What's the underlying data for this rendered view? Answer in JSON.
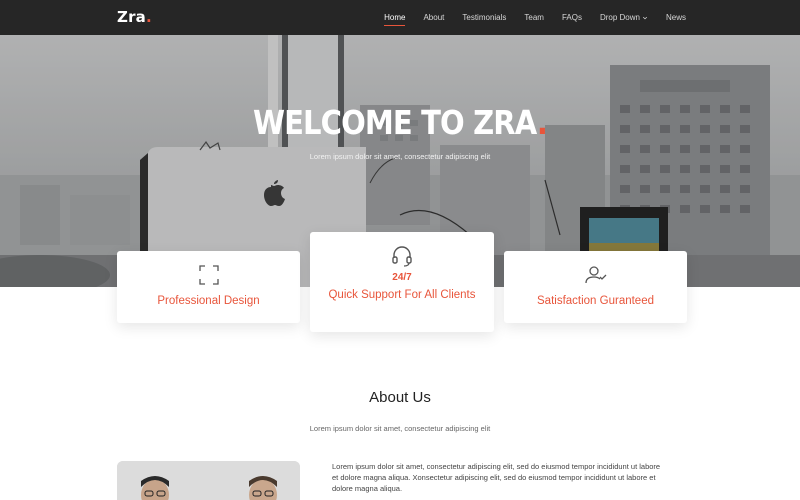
{
  "brand": {
    "name": "Zra",
    "dot": "."
  },
  "nav": {
    "items": [
      {
        "label": "Home",
        "active": true
      },
      {
        "label": "About"
      },
      {
        "label": "Testimonials"
      },
      {
        "label": "Team"
      },
      {
        "label": "FAQs"
      },
      {
        "label": "Drop Down",
        "has_dropdown": true
      },
      {
        "label": "News"
      }
    ]
  },
  "hero": {
    "title": "WELCOME TO ZRA",
    "title_dot": ".",
    "subtitle": "Lorem ipsum dolor sit amet, consectetur adipiscing elit"
  },
  "features": [
    {
      "icon": "expand-icon",
      "title": "Professional Design"
    },
    {
      "icon": "headset-icon",
      "tag": "24/7",
      "title": "Quick Support For All Clients"
    },
    {
      "icon": "user-check-icon",
      "title": "Satisfaction Guranteed"
    }
  ],
  "about": {
    "title": "About Us",
    "subtitle": "Lorem ipsum dolor sit amet, consectetur adipiscing elit",
    "paragraph_line1": "Lorem ipsum dolor sit amet, consectetur adipiscing elit, sed do eiusmod tempor incididunt ut labore",
    "paragraph_line2": "et dolore magna aliqua. Xonsectetur adipiscing elit, sed do eiusmod tempor incididunt ut labore et",
    "paragraph_line3": "dolore magna aliqua."
  },
  "colors": {
    "accent": "#e8553b",
    "nav_bg": "#262626"
  }
}
